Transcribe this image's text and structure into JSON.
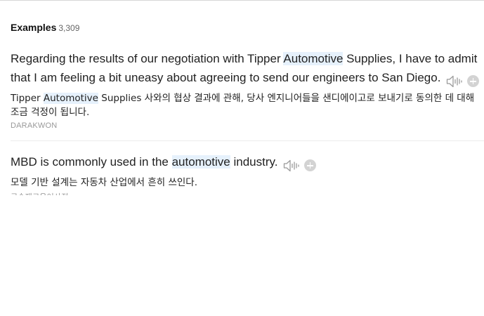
{
  "examples_header": {
    "title": "Examples",
    "count": "3,309"
  },
  "examples": [
    {
      "en_before": "Regarding the results of our negotiation with Tipper ",
      "en_highlight": "Automotive",
      "en_after": " Supplies, I have to admit that I am feeling a bit uneasy about agreeing to send our engineers to San Diego.",
      "ko_before": "Tipper ",
      "ko_highlight": "Automotive",
      "ko_after": " Supplies 사와의 협상 결과에 관해, 당사 엔지니어들을 샌디에이고로 보내기로 동의한 데 대해 조금 걱정이 됩니다.",
      "source": "DARAKWON",
      "icons": [
        "speaker-icon",
        "add-icon"
      ]
    },
    {
      "en_before": "MBD is commonly used in the ",
      "en_highlight": "automotive",
      "en_after": " industry.",
      "ko_before": "모델 기반 설계는 자동차 산업에서 흔히 쓰인다.",
      "ko_highlight": "",
      "ko_after": "",
      "source": "금속재료용어사전",
      "icons": [
        "speaker-icon",
        "add-icon"
      ]
    }
  ],
  "colors": {
    "highlight": "#e6f1fc",
    "text": "#222222",
    "source": "#999999",
    "icon": "#9a9a9a",
    "plus_bg": "#d3d3d3"
  }
}
